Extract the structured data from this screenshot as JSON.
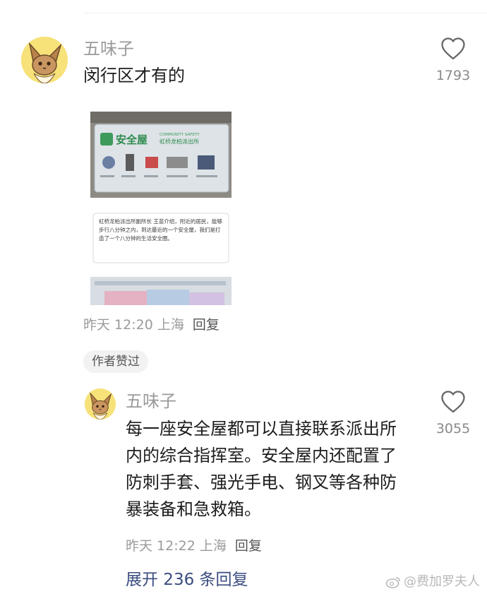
{
  "comment": {
    "username": "五味子",
    "text": "闵行区才有的",
    "likes": "1793",
    "time": "昨天 12:20",
    "location": "上海",
    "reply_label": "回复",
    "image": {
      "sign_title": "安全屋",
      "sign_subtitle": "COMMUNITY SAFETY",
      "sign_station": "虹桥龙柏派出所",
      "sign_caption": "虹桥龙柏派出所副所长 王苗介绍，附近的居民，能够步行八分钟之内，到达最近的一个安全屋，我们是打造了一个八分钟的生活安全圈。"
    }
  },
  "author_badge": "作者赞过",
  "reply": {
    "username": "五味子",
    "text": "每一座安全屋都可以直接联系派出所内的综合指挥室。安全屋内还配置了防刺手套、强光手电、钢叉等各种防暴装备和急救箱。",
    "likes": "3055",
    "time": "昨天 12:22",
    "location": "上海",
    "reply_label": "回复"
  },
  "expand_replies": "展开 236 条回复",
  "watermark": "@费加罗夫人",
  "colors": {
    "avatar_bg": "#f7e27a",
    "link": "#3b4d80",
    "muted": "#9a9a9a"
  }
}
